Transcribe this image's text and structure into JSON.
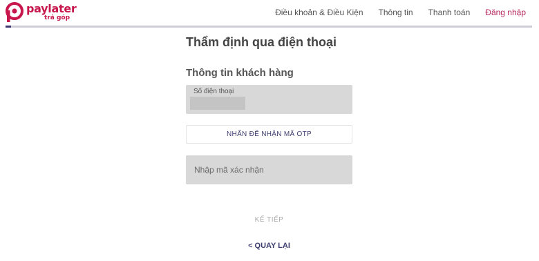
{
  "brand": {
    "name": "paylater",
    "tagline": "trả góp",
    "color": "#c8174d"
  },
  "nav": {
    "items": [
      {
        "label": "Điều khoản & Điều Kiện"
      },
      {
        "label": "Thông tin"
      },
      {
        "label": "Thanh toán"
      },
      {
        "label": "Đăng nhập"
      }
    ]
  },
  "progress": {
    "value": 0.01,
    "fill_color": "#3d3570"
  },
  "form": {
    "title": "Thẩm định qua điện thoại",
    "section_title": "Thông tin khách hàng",
    "phone": {
      "label": "Số điện thoại",
      "value": ""
    },
    "otp_button_label": "NHẤN ĐỂ NHẬN MÃ OTP",
    "code": {
      "placeholder": "Nhập mã xác nhận",
      "value": ""
    },
    "next_label": "KẾ TIẾP",
    "back_label": "< QUAY LẠI"
  }
}
